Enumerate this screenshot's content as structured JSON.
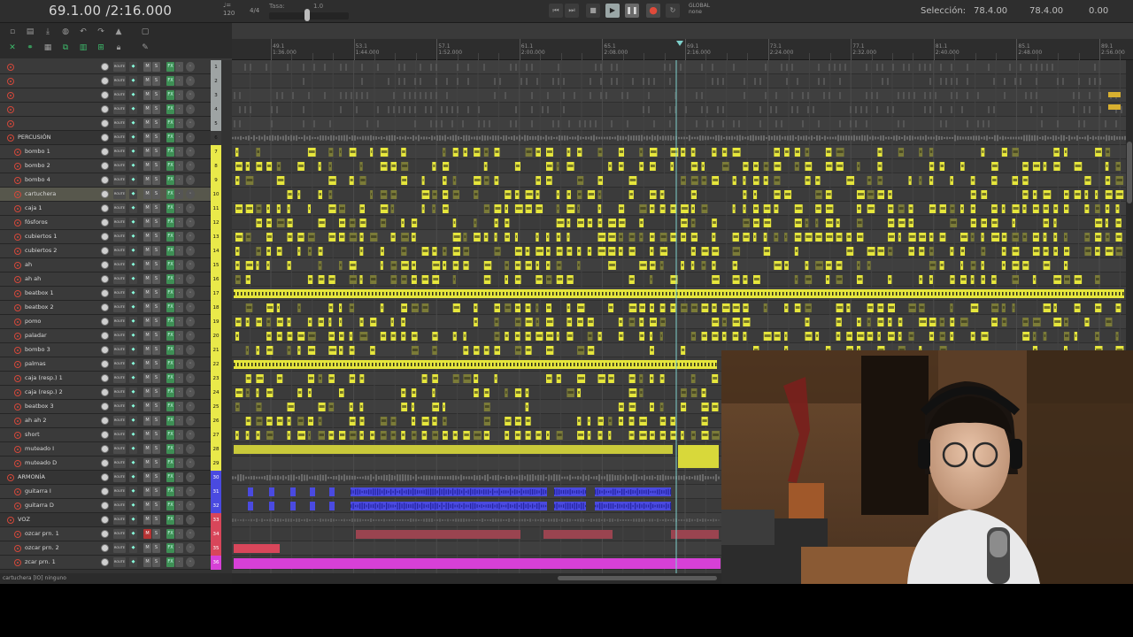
{
  "transport": {
    "time_display": "69.1.00 /2:16.000",
    "tempo_line1": "♩=",
    "tempo_line2": "120",
    "time_sig": "4/4",
    "rate_label": "Tasa:",
    "rate_value": "1.0",
    "global_label": "GLOBAL",
    "global_sub": "none",
    "selection_label": "Selección:",
    "selection_start": "78.4.00",
    "selection_end": "78.4.00",
    "selection_length": "0.00"
  },
  "ruler": {
    "marks": [
      {
        "bar": "49.1",
        "time": "1:36.000"
      },
      {
        "bar": "53.1",
        "time": "1:44.000"
      },
      {
        "bar": "57.1",
        "time": "1:52.000"
      },
      {
        "bar": "61.1",
        "time": "2:00.000"
      },
      {
        "bar": "65.1",
        "time": "2:08.000"
      },
      {
        "bar": "69.1",
        "time": "2:16.000"
      },
      {
        "bar": "73.1",
        "time": "2:24.000"
      },
      {
        "bar": "77.1",
        "time": "2:32.000"
      },
      {
        "bar": "81.1",
        "time": "2:40.000"
      },
      {
        "bar": "85.1",
        "time": "2:48.000"
      },
      {
        "bar": "89.1",
        "time": "2:56.000"
      }
    ]
  },
  "tracks": [
    {
      "num": "1",
      "name": "",
      "color": "#9ea3a3",
      "indent": 0,
      "folder": false
    },
    {
      "num": "2",
      "name": "",
      "color": "#9ea3a3",
      "indent": 0,
      "folder": false
    },
    {
      "num": "3",
      "name": "",
      "color": "#9ea3a3",
      "indent": 0,
      "folder": false
    },
    {
      "num": "4",
      "name": "",
      "color": "#9ea3a3",
      "indent": 0,
      "folder": false
    },
    {
      "num": "5",
      "name": "",
      "color": "#9ea3a3",
      "indent": 0,
      "folder": false
    },
    {
      "num": "6",
      "name": "PERCUSIÓN",
      "color": "#3a3a3a",
      "indent": 0,
      "folder": true
    },
    {
      "num": "7",
      "name": "bombo 1",
      "color": "#e9e94a",
      "indent": 1,
      "folder": false
    },
    {
      "num": "8",
      "name": "bombo 2",
      "color": "#e9e94a",
      "indent": 1,
      "folder": false
    },
    {
      "num": "9",
      "name": "bombo 4",
      "color": "#e9e94a",
      "indent": 1,
      "folder": false
    },
    {
      "num": "10",
      "name": "cartuchera",
      "color": "#e9e94a",
      "indent": 1,
      "folder": false,
      "selected": true
    },
    {
      "num": "11",
      "name": "caja 1",
      "color": "#e9e94a",
      "indent": 1,
      "folder": false
    },
    {
      "num": "12",
      "name": "fósforos",
      "color": "#e9e94a",
      "indent": 1,
      "folder": false
    },
    {
      "num": "13",
      "name": "cubiertos 1",
      "color": "#e9e94a",
      "indent": 1,
      "folder": false
    },
    {
      "num": "14",
      "name": "cubiertos 2",
      "color": "#e9e94a",
      "indent": 1,
      "folder": false
    },
    {
      "num": "15",
      "name": "ah",
      "color": "#e9e94a",
      "indent": 1,
      "folder": false
    },
    {
      "num": "16",
      "name": "ah ah",
      "color": "#e9e94a",
      "indent": 1,
      "folder": false
    },
    {
      "num": "17",
      "name": "beatbox 1",
      "color": "#e9e94a",
      "indent": 1,
      "folder": false
    },
    {
      "num": "18",
      "name": "beatbox 2",
      "color": "#e9e94a",
      "indent": 1,
      "folder": false
    },
    {
      "num": "19",
      "name": "pomo",
      "color": "#e9e94a",
      "indent": 1,
      "folder": false
    },
    {
      "num": "20",
      "name": "paladar",
      "color": "#e9e94a",
      "indent": 1,
      "folder": false
    },
    {
      "num": "21",
      "name": "bombo 3",
      "color": "#e9e94a",
      "indent": 1,
      "folder": false
    },
    {
      "num": "22",
      "name": "palmas",
      "color": "#e9e94a",
      "indent": 1,
      "folder": false
    },
    {
      "num": "23",
      "name": "caja (resp.) 1",
      "color": "#e9e94a",
      "indent": 1,
      "folder": false
    },
    {
      "num": "24",
      "name": "caja (resp.) 2",
      "color": "#e9e94a",
      "indent": 1,
      "folder": false
    },
    {
      "num": "25",
      "name": "beatbox 3",
      "color": "#e9e94a",
      "indent": 1,
      "folder": false
    },
    {
      "num": "26",
      "name": "ah ah 2",
      "color": "#e9e94a",
      "indent": 1,
      "folder": false
    },
    {
      "num": "27",
      "name": "short",
      "color": "#e9e94a",
      "indent": 1,
      "folder": false
    },
    {
      "num": "28",
      "name": "muteado I",
      "color": "#e9e94a",
      "indent": 1,
      "folder": false
    },
    {
      "num": "29",
      "name": "muteado D",
      "color": "#e9e94a",
      "indent": 1,
      "folder": false
    },
    {
      "num": "30",
      "name": "ARMONÍA",
      "color": "#4a4ae0",
      "indent": 0,
      "folder": true
    },
    {
      "num": "31",
      "name": "guitarra I",
      "color": "#4a4ae0",
      "indent": 1,
      "folder": false
    },
    {
      "num": "32",
      "name": "guitarra D",
      "color": "#4a4ae0",
      "indent": 1,
      "folder": false
    },
    {
      "num": "33",
      "name": "VOZ",
      "color": "#d8465a",
      "indent": 0,
      "folder": true
    },
    {
      "num": "34",
      "name": "ozcar prn. 1",
      "color": "#d8465a",
      "indent": 1,
      "folder": false,
      "armed": true
    },
    {
      "num": "35",
      "name": "ozcar prn. 2",
      "color": "#d8465a",
      "indent": 1,
      "folder": false
    },
    {
      "num": "36",
      "name": "zcar prn. 1",
      "color": "#d640d6",
      "indent": 1,
      "folder": false
    }
  ],
  "buttons": {
    "route": "ROUTE",
    "mute": "M",
    "solo": "S",
    "fx": "FX"
  },
  "status": "cartuchera [IO] ninguno"
}
